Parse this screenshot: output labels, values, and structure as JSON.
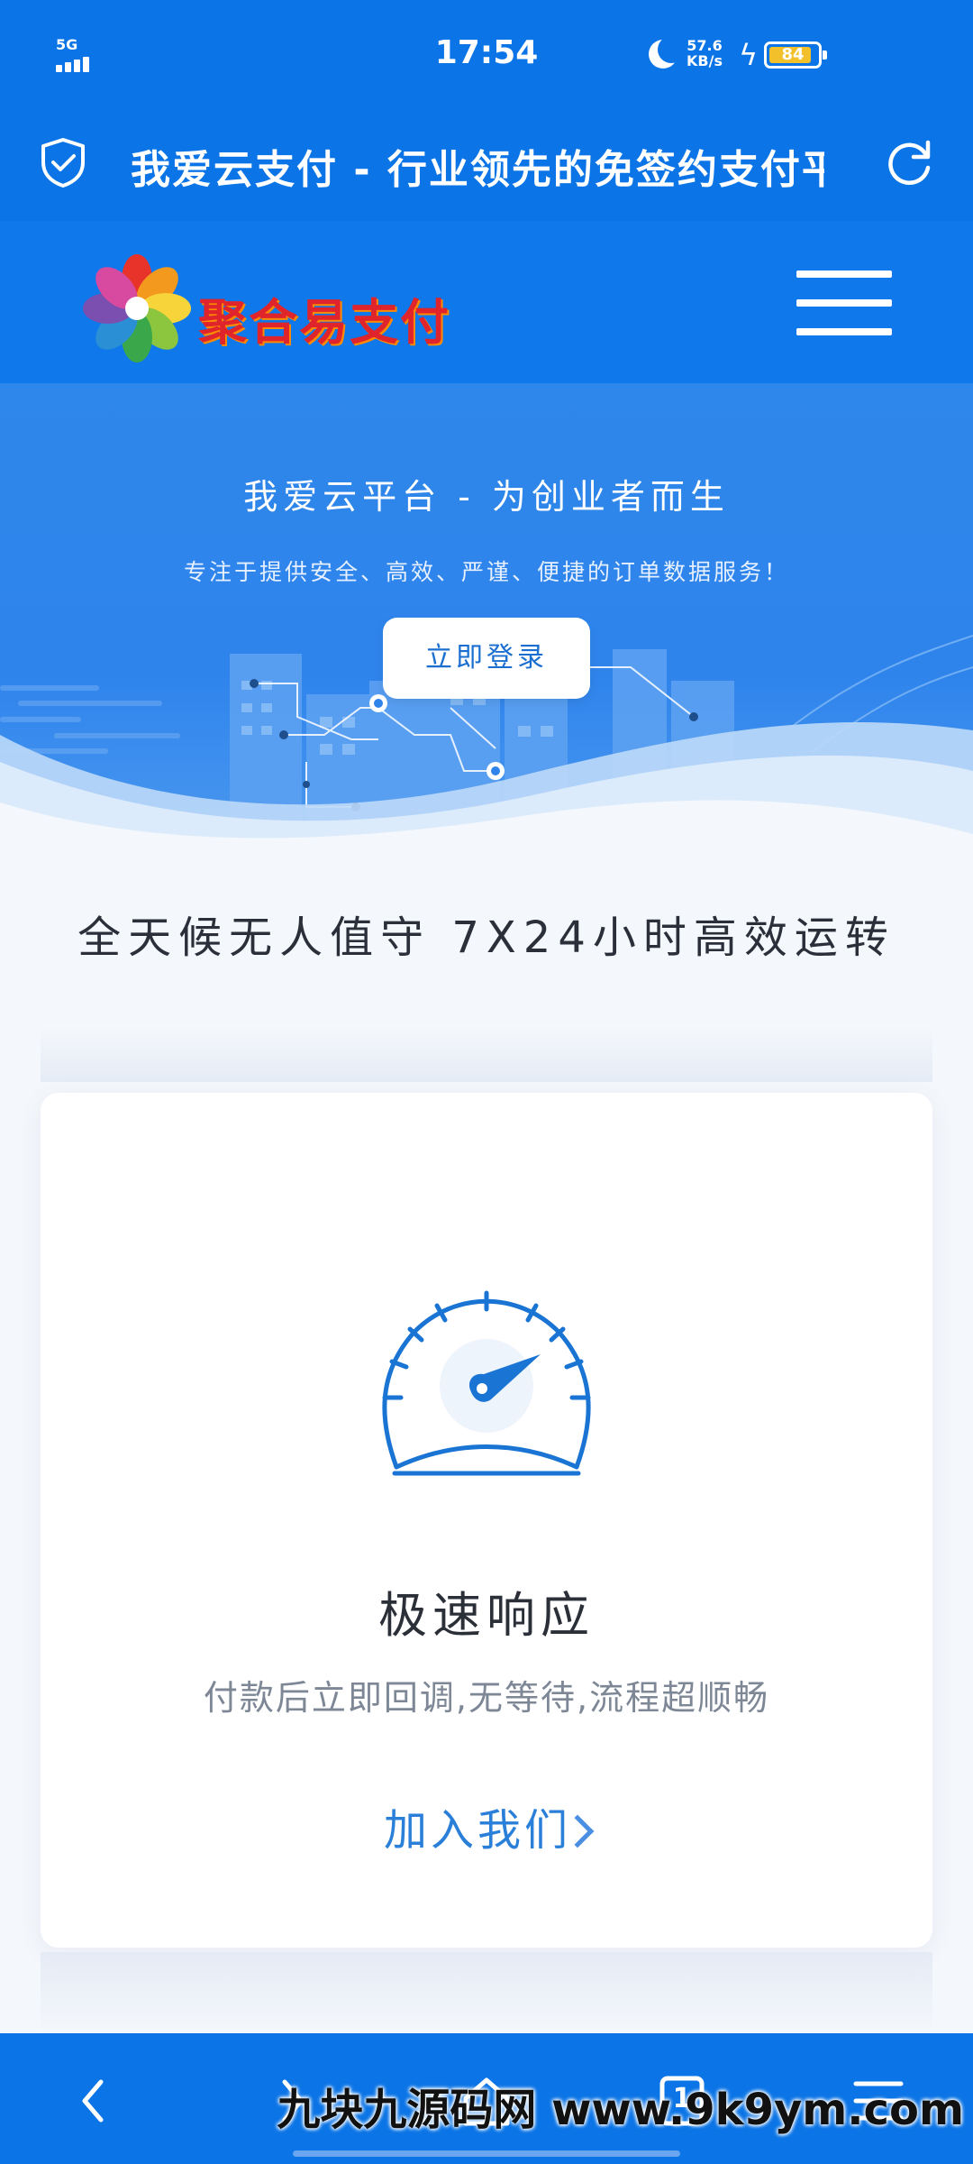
{
  "status_bar": {
    "network": "5G",
    "time": "17:54",
    "speed_value": "57.6",
    "speed_unit": "KB/s",
    "battery": "84"
  },
  "browser": {
    "page_title": "我爱云支付 - 行业领先的免签约支付平台",
    "icons": [
      "shield-check-icon",
      "refresh-icon"
    ]
  },
  "site_header": {
    "logo_text": "聚合易支付",
    "menu_icon": "hamburger-menu-icon"
  },
  "hero": {
    "title": "我爱云平台 - 为创业者而生",
    "subtitle": "专注于提供安全、高效、严谨、便捷的订单数据服务！",
    "login_button": "立即登录"
  },
  "section": {
    "title": "全天候无人值守 7X24小时高效运转"
  },
  "card": {
    "icon": "speedometer-icon",
    "title": "极速响应",
    "description": "付款后立即回调,无等待,流程超顺畅",
    "link": "加入我们"
  },
  "bottom_nav": {
    "tab_count": "1",
    "icons": [
      "back-icon",
      "forward-icon",
      "home-icon",
      "tabs-icon",
      "menu-icon"
    ]
  },
  "watermark": "九块九源码网 www.9k9ym.com",
  "colors": {
    "primary": "#0b74e6",
    "accent_text": "#2a7fd9",
    "logo_red": "#e0242c"
  }
}
